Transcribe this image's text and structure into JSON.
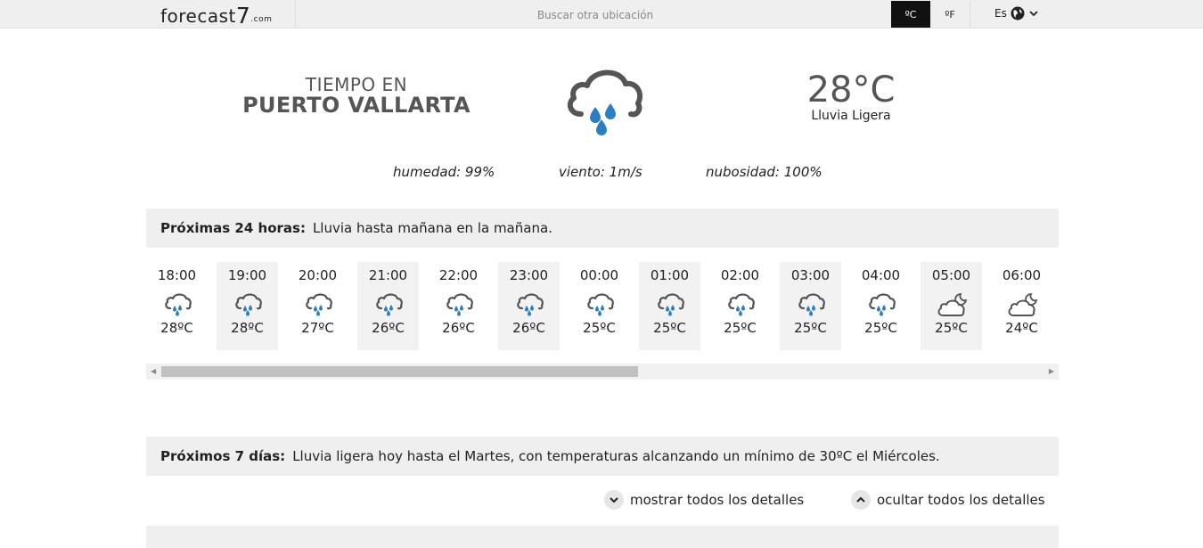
{
  "header": {
    "logo": {
      "main": "forecast",
      "seven": "7",
      "suffix": ".com"
    },
    "search_placeholder": "Buscar otra ubicación",
    "unit_c": "ºC",
    "unit_f": "ºF",
    "lang": "Es",
    "icons": {
      "lang": "globe-icon",
      "dropdown": "chevron-down-icon"
    }
  },
  "location": {
    "line1": "TIEMPO EN",
    "line2": "PUERTO VALLARTA"
  },
  "current": {
    "temp": "28°C",
    "condition": "Lluvia Ligera",
    "icon": "cloud-rain-icon",
    "humidity": "humedad: 99%",
    "wind": "viento: 1m/s",
    "clouds": "nubosidad: 100%"
  },
  "next24": {
    "label": "Próximas 24 horas:",
    "summary": "Lluvia hasta mañana en la mañana.",
    "hours": [
      {
        "time": "18:00",
        "temp": "28ºC",
        "icon": "cloud-rain-icon"
      },
      {
        "time": "19:00",
        "temp": "28ºC",
        "icon": "cloud-rain-icon"
      },
      {
        "time": "20:00",
        "temp": "27ºC",
        "icon": "cloud-rain-icon"
      },
      {
        "time": "21:00",
        "temp": "26ºC",
        "icon": "cloud-rain-icon"
      },
      {
        "time": "22:00",
        "temp": "26ºC",
        "icon": "cloud-rain-icon"
      },
      {
        "time": "23:00",
        "temp": "26ºC",
        "icon": "cloud-rain-icon"
      },
      {
        "time": "00:00",
        "temp": "25ºC",
        "icon": "cloud-rain-icon"
      },
      {
        "time": "01:00",
        "temp": "25ºC",
        "icon": "cloud-rain-icon"
      },
      {
        "time": "02:00",
        "temp": "25ºC",
        "icon": "cloud-rain-icon"
      },
      {
        "time": "03:00",
        "temp": "25ºC",
        "icon": "cloud-rain-icon"
      },
      {
        "time": "04:00",
        "temp": "25ºC",
        "icon": "cloud-rain-icon"
      },
      {
        "time": "05:00",
        "temp": "25ºC",
        "icon": "cloud-moon-icon"
      },
      {
        "time": "06:00",
        "temp": "24ºC",
        "icon": "cloud-moon-icon"
      }
    ]
  },
  "next7": {
    "label": "Próximos 7 días:",
    "summary": "Lluvia ligera hoy hasta el Martes, con temperaturas alcanzando un mínimo de 30ºC el Miércoles.",
    "show_all": "mostrar todos los detalles",
    "hide_all": "ocultar todos los detalles"
  },
  "colors": {
    "accent": "#2a7fc4",
    "icon_gray": "#555555",
    "bar_bg": "#efefef"
  }
}
